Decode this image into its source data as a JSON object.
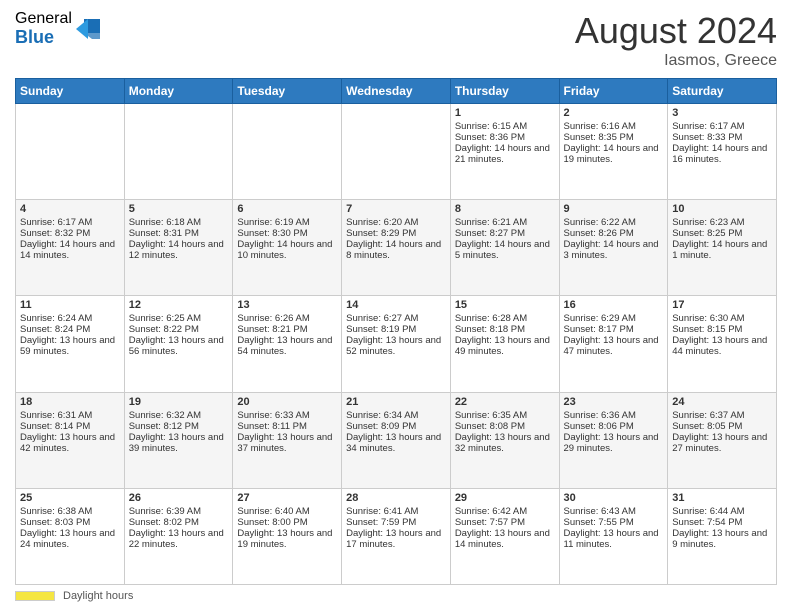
{
  "header": {
    "logo_general": "General",
    "logo_blue": "Blue",
    "month_year": "August 2024",
    "location": "Iasmos, Greece"
  },
  "days_of_week": [
    "Sunday",
    "Monday",
    "Tuesday",
    "Wednesday",
    "Thursday",
    "Friday",
    "Saturday"
  ],
  "weeks": [
    [
      {
        "day": "",
        "sunrise": "",
        "sunset": "",
        "daylight": ""
      },
      {
        "day": "",
        "sunrise": "",
        "sunset": "",
        "daylight": ""
      },
      {
        "day": "",
        "sunrise": "",
        "sunset": "",
        "daylight": ""
      },
      {
        "day": "",
        "sunrise": "",
        "sunset": "",
        "daylight": ""
      },
      {
        "day": "1",
        "sunrise": "Sunrise: 6:15 AM",
        "sunset": "Sunset: 8:36 PM",
        "daylight": "Daylight: 14 hours and 21 minutes."
      },
      {
        "day": "2",
        "sunrise": "Sunrise: 6:16 AM",
        "sunset": "Sunset: 8:35 PM",
        "daylight": "Daylight: 14 hours and 19 minutes."
      },
      {
        "day": "3",
        "sunrise": "Sunrise: 6:17 AM",
        "sunset": "Sunset: 8:33 PM",
        "daylight": "Daylight: 14 hours and 16 minutes."
      }
    ],
    [
      {
        "day": "4",
        "sunrise": "Sunrise: 6:17 AM",
        "sunset": "Sunset: 8:32 PM",
        "daylight": "Daylight: 14 hours and 14 minutes."
      },
      {
        "day": "5",
        "sunrise": "Sunrise: 6:18 AM",
        "sunset": "Sunset: 8:31 PM",
        "daylight": "Daylight: 14 hours and 12 minutes."
      },
      {
        "day": "6",
        "sunrise": "Sunrise: 6:19 AM",
        "sunset": "Sunset: 8:30 PM",
        "daylight": "Daylight: 14 hours and 10 minutes."
      },
      {
        "day": "7",
        "sunrise": "Sunrise: 6:20 AM",
        "sunset": "Sunset: 8:29 PM",
        "daylight": "Daylight: 14 hours and 8 minutes."
      },
      {
        "day": "8",
        "sunrise": "Sunrise: 6:21 AM",
        "sunset": "Sunset: 8:27 PM",
        "daylight": "Daylight: 14 hours and 5 minutes."
      },
      {
        "day": "9",
        "sunrise": "Sunrise: 6:22 AM",
        "sunset": "Sunset: 8:26 PM",
        "daylight": "Daylight: 14 hours and 3 minutes."
      },
      {
        "day": "10",
        "sunrise": "Sunrise: 6:23 AM",
        "sunset": "Sunset: 8:25 PM",
        "daylight": "Daylight: 14 hours and 1 minute."
      }
    ],
    [
      {
        "day": "11",
        "sunrise": "Sunrise: 6:24 AM",
        "sunset": "Sunset: 8:24 PM",
        "daylight": "Daylight: 13 hours and 59 minutes."
      },
      {
        "day": "12",
        "sunrise": "Sunrise: 6:25 AM",
        "sunset": "Sunset: 8:22 PM",
        "daylight": "Daylight: 13 hours and 56 minutes."
      },
      {
        "day": "13",
        "sunrise": "Sunrise: 6:26 AM",
        "sunset": "Sunset: 8:21 PM",
        "daylight": "Daylight: 13 hours and 54 minutes."
      },
      {
        "day": "14",
        "sunrise": "Sunrise: 6:27 AM",
        "sunset": "Sunset: 8:19 PM",
        "daylight": "Daylight: 13 hours and 52 minutes."
      },
      {
        "day": "15",
        "sunrise": "Sunrise: 6:28 AM",
        "sunset": "Sunset: 8:18 PM",
        "daylight": "Daylight: 13 hours and 49 minutes."
      },
      {
        "day": "16",
        "sunrise": "Sunrise: 6:29 AM",
        "sunset": "Sunset: 8:17 PM",
        "daylight": "Daylight: 13 hours and 47 minutes."
      },
      {
        "day": "17",
        "sunrise": "Sunrise: 6:30 AM",
        "sunset": "Sunset: 8:15 PM",
        "daylight": "Daylight: 13 hours and 44 minutes."
      }
    ],
    [
      {
        "day": "18",
        "sunrise": "Sunrise: 6:31 AM",
        "sunset": "Sunset: 8:14 PM",
        "daylight": "Daylight: 13 hours and 42 minutes."
      },
      {
        "day": "19",
        "sunrise": "Sunrise: 6:32 AM",
        "sunset": "Sunset: 8:12 PM",
        "daylight": "Daylight: 13 hours and 39 minutes."
      },
      {
        "day": "20",
        "sunrise": "Sunrise: 6:33 AM",
        "sunset": "Sunset: 8:11 PM",
        "daylight": "Daylight: 13 hours and 37 minutes."
      },
      {
        "day": "21",
        "sunrise": "Sunrise: 6:34 AM",
        "sunset": "Sunset: 8:09 PM",
        "daylight": "Daylight: 13 hours and 34 minutes."
      },
      {
        "day": "22",
        "sunrise": "Sunrise: 6:35 AM",
        "sunset": "Sunset: 8:08 PM",
        "daylight": "Daylight: 13 hours and 32 minutes."
      },
      {
        "day": "23",
        "sunrise": "Sunrise: 6:36 AM",
        "sunset": "Sunset: 8:06 PM",
        "daylight": "Daylight: 13 hours and 29 minutes."
      },
      {
        "day": "24",
        "sunrise": "Sunrise: 6:37 AM",
        "sunset": "Sunset: 8:05 PM",
        "daylight": "Daylight: 13 hours and 27 minutes."
      }
    ],
    [
      {
        "day": "25",
        "sunrise": "Sunrise: 6:38 AM",
        "sunset": "Sunset: 8:03 PM",
        "daylight": "Daylight: 13 hours and 24 minutes."
      },
      {
        "day": "26",
        "sunrise": "Sunrise: 6:39 AM",
        "sunset": "Sunset: 8:02 PM",
        "daylight": "Daylight: 13 hours and 22 minutes."
      },
      {
        "day": "27",
        "sunrise": "Sunrise: 6:40 AM",
        "sunset": "Sunset: 8:00 PM",
        "daylight": "Daylight: 13 hours and 19 minutes."
      },
      {
        "day": "28",
        "sunrise": "Sunrise: 6:41 AM",
        "sunset": "Sunset: 7:59 PM",
        "daylight": "Daylight: 13 hours and 17 minutes."
      },
      {
        "day": "29",
        "sunrise": "Sunrise: 6:42 AM",
        "sunset": "Sunset: 7:57 PM",
        "daylight": "Daylight: 13 hours and 14 minutes."
      },
      {
        "day": "30",
        "sunrise": "Sunrise: 6:43 AM",
        "sunset": "Sunset: 7:55 PM",
        "daylight": "Daylight: 13 hours and 11 minutes."
      },
      {
        "day": "31",
        "sunrise": "Sunrise: 6:44 AM",
        "sunset": "Sunset: 7:54 PM",
        "daylight": "Daylight: 13 hours and 9 minutes."
      }
    ]
  ],
  "footer": {
    "label": "Daylight hours"
  }
}
